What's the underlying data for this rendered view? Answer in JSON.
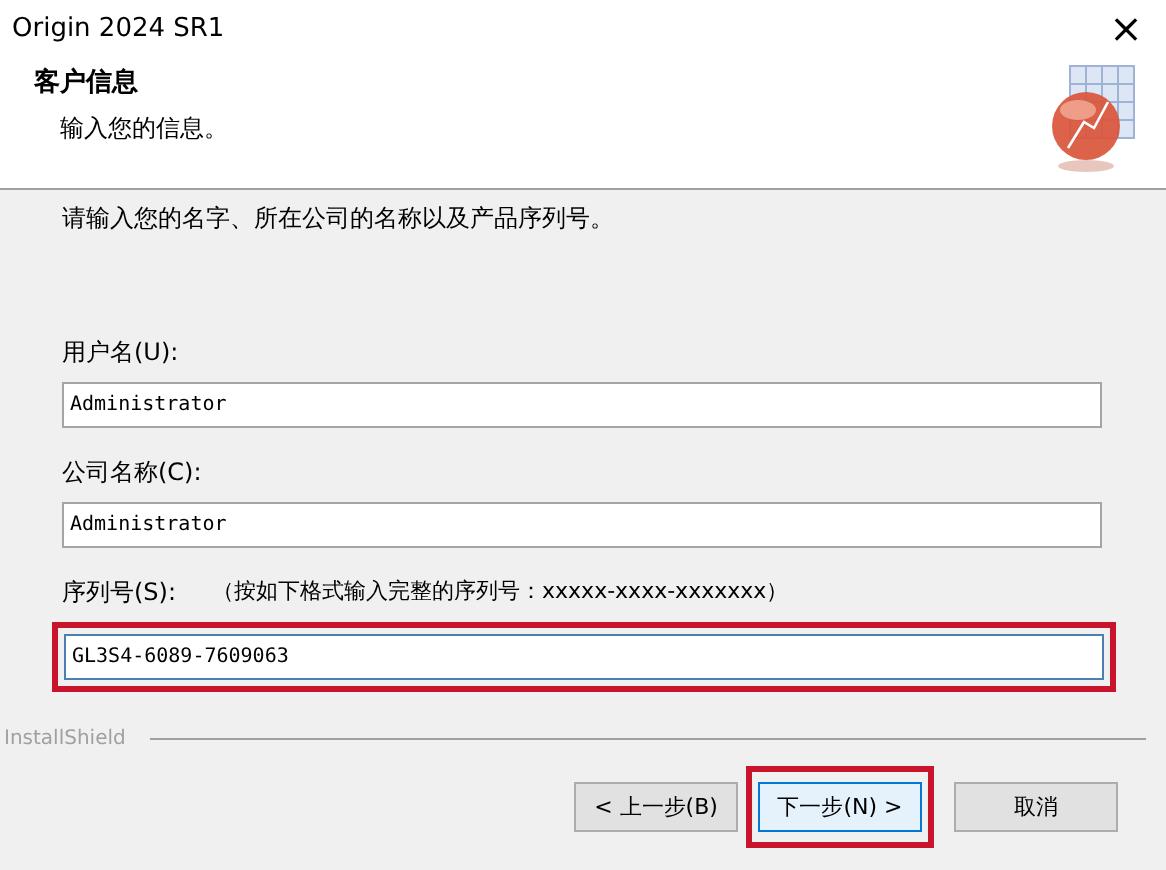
{
  "window": {
    "title": "Origin 2024 SR1",
    "close": "×"
  },
  "header": {
    "title": "客户信息",
    "subtitle": "输入您的信息。"
  },
  "instruction": "请输入您的名字、所在公司的名称以及产品序列号。",
  "fields": [
    {
      "label": "用户名(U):",
      "value": "Administrator",
      "highlighted": false
    },
    {
      "label": "公司名称(C):",
      "value": "Administrator",
      "highlighted": false
    },
    {
      "label": "序列号(S):",
      "hint": "（按如下格式输入完整的序列号：xxxxx-xxxx-xxxxxxx）",
      "value": "GL3S4-6089-7609063",
      "highlighted": true
    }
  ],
  "brand": "InstallShield",
  "buttons": [
    {
      "label": "< 上一步(B)",
      "default": false,
      "highlighted": false
    },
    {
      "label": "下一步(N) >",
      "default": true,
      "highlighted": true
    },
    {
      "label": "取消",
      "default": false,
      "highlighted": false
    }
  ]
}
